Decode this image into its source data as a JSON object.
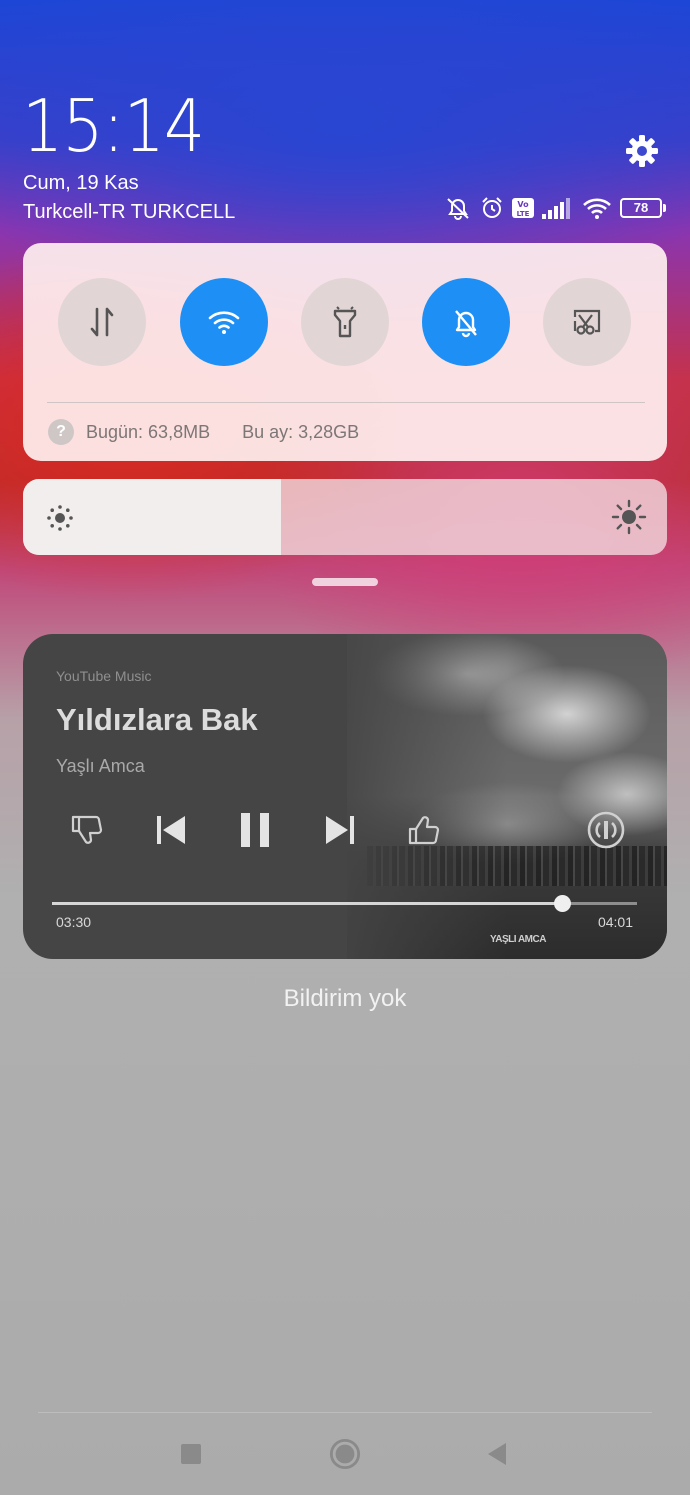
{
  "status": {
    "time": "15:14",
    "date": "Cum, 19 Kas",
    "carrier": "Turkcell-TR TURKCELL",
    "battery": "78",
    "icons": [
      "mute-icon",
      "alarm-icon",
      "volte-icon",
      "signal-icon",
      "wifi-icon",
      "battery-icon"
    ]
  },
  "quick_settings": {
    "toggles": [
      {
        "name": "mobile-data",
        "icon": "data-arrows-icon",
        "on": false
      },
      {
        "name": "wifi",
        "icon": "wifi-icon",
        "on": true
      },
      {
        "name": "flashlight",
        "icon": "flashlight-icon",
        "on": false
      },
      {
        "name": "silent",
        "icon": "bell-off-icon",
        "on": true
      },
      {
        "name": "screenshot",
        "icon": "screenshot-scissors-icon",
        "on": false
      }
    ],
    "data_today": "Bugün: 63,8MB",
    "data_month": "Bu ay: 3,28GB",
    "help_glyph": "?"
  },
  "brightness": {
    "level": 0.4
  },
  "media": {
    "app": "YouTube Music",
    "title": "Yıldızlara Bak",
    "artist": "Yaşlı Amca",
    "current_time": "03:30",
    "total_time": "04:01",
    "progress": 0.871,
    "album_logo": "YAŞLI AMCA",
    "controls": [
      "dislike-icon",
      "previous-icon",
      "pause-icon",
      "next-icon",
      "like-icon",
      "cast-icon"
    ]
  },
  "notifications": {
    "empty_label": "Bildirim yok"
  },
  "colors": {
    "accent": "#1e90f5",
    "toggle_off": "#e2d5d5"
  }
}
